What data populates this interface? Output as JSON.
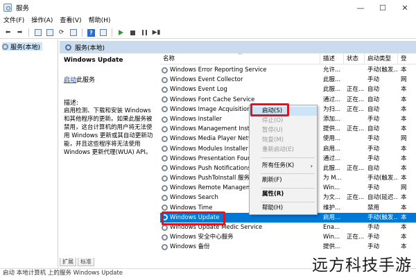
{
  "window": {
    "title": "服务",
    "controls": [
      "—",
      "☐",
      "✕"
    ]
  },
  "menu": [
    "文件(F)",
    "操作(A)",
    "查看(V)",
    "帮助(H)"
  ],
  "toolbar_icons": [
    "back-arrow-icon",
    "forward-arrow-icon",
    "console-tree-icon",
    "list-view-icon",
    "refresh-icon",
    "export-icon",
    "help-icon",
    "properties-icon",
    "start-icon",
    "stop-icon",
    "pause-icon",
    "restart-icon"
  ],
  "tree": {
    "item": "服务(本地)"
  },
  "header": {
    "label": "服务(本地)"
  },
  "details": {
    "service_title": "Windows Update",
    "start_link": "启动",
    "start_suffix": "此服务",
    "desc_label": "描述:",
    "desc_text": "启用检测、下载和安装 Windows 和其他程序的更新。如果此服务被禁用，这台计算机的用户将无法使用 Windows 更新或其自动更新功能，并且这些程序将无法使用 Windows 更新代理(WUA) API。"
  },
  "columns": {
    "name": "名称",
    "desc": "描述",
    "status": "状态",
    "start": "启动类型",
    "login": "登"
  },
  "rows": [
    {
      "name": "Windows Error Reporting Service",
      "desc": "允许...",
      "status": "",
      "start": "手动(触发...",
      "login": "本"
    },
    {
      "name": "Windows Event Collector",
      "desc": "此服...",
      "status": "",
      "start": "手动",
      "login": "网"
    },
    {
      "name": "Windows Event Log",
      "desc": "此服...",
      "status": "正在...",
      "start": "自动",
      "login": "本"
    },
    {
      "name": "Windows Font Cache Service",
      "desc": "通过...",
      "status": "正在...",
      "start": "自动",
      "login": "本"
    },
    {
      "name": "Windows Image Acquisition",
      "desc": "为扫...",
      "status": "正在...",
      "start": "自动",
      "login": "本"
    },
    {
      "name": "Windows Installer",
      "desc": "添加...",
      "status": "",
      "start": "手动",
      "login": "本"
    },
    {
      "name": "Windows Management Instr",
      "desc": "提供...",
      "status": "正在...",
      "start": "自动",
      "login": "本"
    },
    {
      "name": "Windows Media Player Netw",
      "desc": "使用...",
      "status": "",
      "start": "手动",
      "login": "网"
    },
    {
      "name": "Windows Modules Installer",
      "desc": "启用...",
      "status": "",
      "start": "手动",
      "login": "本"
    },
    {
      "name": "Windows Presentation Foun",
      "desc": "通过...",
      "status": "",
      "start": "手动",
      "login": "本"
    },
    {
      "name": "Windows Push Notifications",
      "desc": "此服...",
      "status": "正在...",
      "start": "自动",
      "login": "本"
    },
    {
      "name": "Windows PushToInstall 服务",
      "desc": "为 M...",
      "status": "",
      "start": "手动(触发...",
      "login": "本"
    },
    {
      "name": "Windows Remote Managem",
      "desc": "Win...",
      "status": "",
      "start": "手动",
      "login": "网"
    },
    {
      "name": "Windows Search",
      "desc": "为文...",
      "status": "正在...",
      "start": "自动(延迟...",
      "login": "本"
    },
    {
      "name": "Windows Time",
      "desc": "维护...",
      "status": "",
      "start": "禁用",
      "login": "本"
    },
    {
      "name": "Windows Update",
      "desc": "启用...",
      "status": "",
      "start": "手动(触发...",
      "login": "本",
      "selected": true
    },
    {
      "name": "Windows Update Medic Service",
      "desc": "Ena...",
      "status": "",
      "start": "手动",
      "login": "本"
    },
    {
      "name": "Windows 安全中心服务",
      "desc": "Win...",
      "status": "正在...",
      "start": "手动",
      "login": "本"
    },
    {
      "name": "Windows 备份",
      "desc": "提供...",
      "status": "",
      "start": "手动",
      "login": "本"
    }
  ],
  "context_menu": {
    "start": "启动(S)",
    "stop": "停止(O)",
    "pause": "暂停(U)",
    "resume": "恢复(M)",
    "restart": "重新启动(E)",
    "all_tasks": "所有任务(K)",
    "refresh": "刷新(F)",
    "properties": "属性(R)",
    "help": "帮助(H)"
  },
  "tabs": [
    "扩展",
    "标准"
  ],
  "statusbar": "启动 本地计算机 上的服务 Windows Update",
  "watermark": "远方科技手游",
  "colors": {
    "selection": "#0078d7",
    "header_band": "#cbdbee",
    "highlight_box": "#e0141e",
    "menu_hover": "#cde4f7"
  }
}
